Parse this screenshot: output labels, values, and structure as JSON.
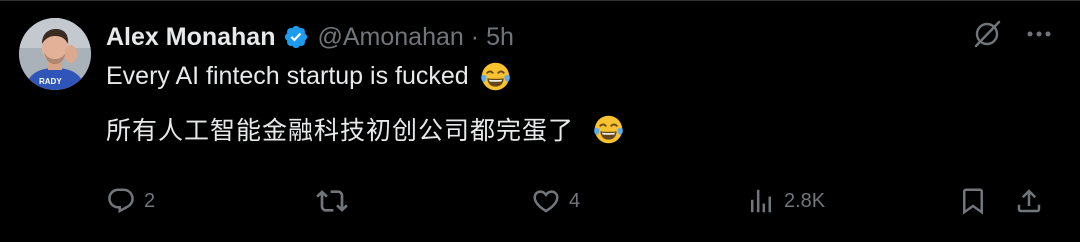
{
  "author": {
    "display_name": "Alex Monahan",
    "handle": "@Amonahan",
    "separator": "·",
    "time": "5h",
    "avatar_shirt_text": "RADY"
  },
  "tweet": {
    "line1": "Every AI fintech startup is fucked",
    "line2": "所有人工智能金融科技初创公司都完蛋了"
  },
  "actions": {
    "replies": "2",
    "reposts": "",
    "likes": "4",
    "views": "2.8K"
  },
  "icons": {
    "verified": "verified-badge-icon",
    "grok": "grok-icon",
    "more": "more-icon",
    "reply": "reply-icon",
    "repost": "repost-icon",
    "like": "heart-icon",
    "views": "views-icon",
    "bookmark": "bookmark-icon",
    "share": "share-icon",
    "emoji": "face-with-tears-of-joy-emoji"
  },
  "colors": {
    "background": "#000000",
    "primary_text": "#e7e9ea",
    "secondary_text": "#71767b",
    "verified_blue": "#1d9bf0"
  }
}
